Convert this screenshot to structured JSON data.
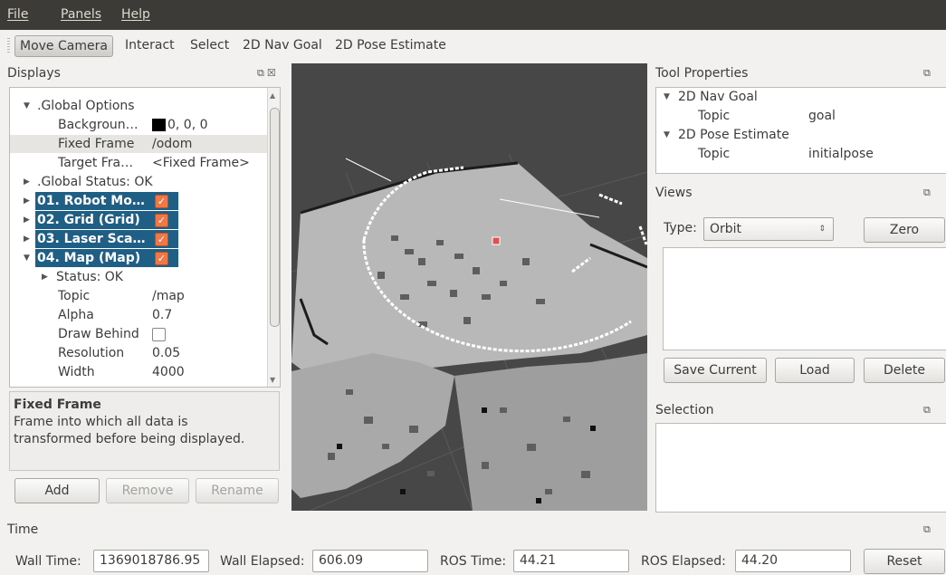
{
  "menu": {
    "file": "File",
    "panels": "Panels",
    "help": "Help"
  },
  "toolbar": {
    "move_camera": "Move Camera",
    "interact": "Interact",
    "select": "Select",
    "nav_goal": "2D Nav Goal",
    "pose_estimate": "2D Pose Estimate"
  },
  "displays": {
    "title": "Displays",
    "global_options": ".Global Options",
    "background_key": "Backgroun…",
    "background_val": "0, 0, 0",
    "background_color": "#000000",
    "fixed_frame_key": "Fixed Frame",
    "fixed_frame_val": "/odom",
    "target_frame_key": "Target Fra…",
    "target_frame_val": "<Fixed Frame>",
    "global_status": ".Global Status: OK",
    "robot_model": "01. Robot Mo…",
    "grid": "02. Grid (Grid)",
    "laser": "03. Laser Sca…",
    "map": "04. Map (Map)",
    "map_status": "Status: OK",
    "topic_key": "Topic",
    "topic_val": "/map",
    "alpha_key": "Alpha",
    "alpha_val": "0.7",
    "draw_behind_key": "Draw Behind",
    "resolution_key": "Resolution",
    "resolution_val": "0.05",
    "width_key": "Width",
    "width_val": "4000",
    "accent_color": "#1f5f86",
    "check_color": "#f07746"
  },
  "help": {
    "title": "Fixed Frame",
    "text_line1": "Frame into which all data is",
    "text_line2": "transformed before being displayed."
  },
  "displays_buttons": {
    "add": "Add",
    "remove": "Remove",
    "rename": "Rename"
  },
  "tool_properties": {
    "title": "Tool Properties",
    "nav_goal": "2D Nav Goal",
    "nav_topic_key": "Topic",
    "nav_topic_val": "goal",
    "pose_estimate": "2D Pose Estimate",
    "pose_topic_key": "Topic",
    "pose_topic_val": "initialpose"
  },
  "views": {
    "title": "Views",
    "type_label": "Type:",
    "type_value": "Orbit",
    "zero": "Zero",
    "save_current": "Save Current",
    "load": "Load",
    "delete": "Delete"
  },
  "selection": {
    "title": "Selection"
  },
  "time": {
    "title": "Time",
    "wall_time_label": "Wall Time:",
    "wall_time": "1369018786.95",
    "wall_elapsed_label": "Wall Elapsed:",
    "wall_elapsed": "606.09",
    "ros_time_label": "ROS Time:",
    "ros_time": "44.21",
    "ros_elapsed_label": "ROS Elapsed:",
    "ros_elapsed": "44.20",
    "reset": "Reset"
  }
}
